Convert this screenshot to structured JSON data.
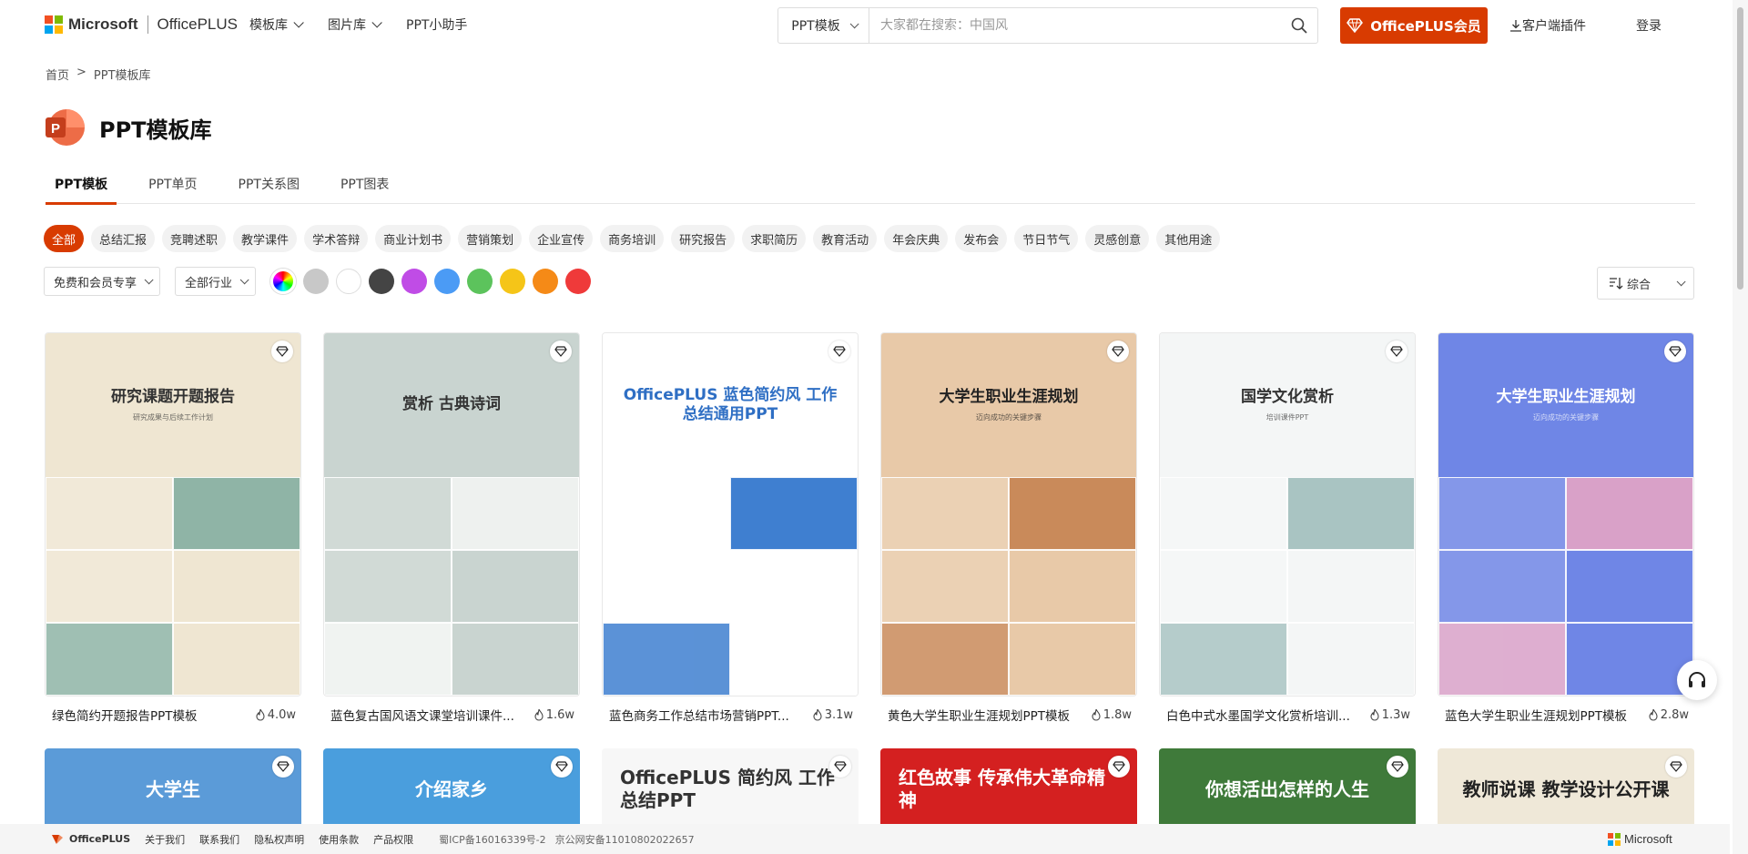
{
  "header": {
    "ms_text": "Microsoft",
    "brand": "OfficePLUS",
    "nav": [
      {
        "label": "模板库",
        "has_dropdown": true
      },
      {
        "label": "图片库",
        "has_dropdown": true
      },
      {
        "label": "PPT小助手",
        "has_dropdown": false
      }
    ],
    "search": {
      "type_label": "PPT模板",
      "placeholder": "大家都在搜索：中国风"
    },
    "vip_label": "OfficePLUS会员",
    "client_label": "客户端插件",
    "login_label": "登录"
  },
  "breadcrumb": {
    "home": "首页",
    "sep": ">",
    "current": "PPT模板库"
  },
  "page_title": "PPT模板库",
  "tabs": [
    "PPT模板",
    "PPT单页",
    "PPT关系图",
    "PPT图表"
  ],
  "categories": [
    "全部",
    "总结汇报",
    "竞聘述职",
    "教学课件",
    "学术答辩",
    "商业计划书",
    "营销策划",
    "企业宣传",
    "商务培训",
    "研究报告",
    "求职简历",
    "教育活动",
    "年会庆典",
    "发布会",
    "节日节气",
    "灵感创意",
    "其他用途"
  ],
  "filters": {
    "license_label": "免费和会员专享",
    "industry_label": "全部行业",
    "colors": [
      "rainbow",
      "#c8c8c8",
      "#ffffff",
      "#444444",
      "#c04ce6",
      "#4b9bf5",
      "#5cc35c",
      "#f5c518",
      "#f58a17",
      "#ef3a3a"
    ],
    "sort_label": "综合"
  },
  "cards": [
    {
      "title": "绿色简约开题报告PPT模板",
      "views": "4.0w",
      "cover_text": "研究课题开题报告",
      "cover_sub": "研究成果与后续工作计划",
      "bg": "#efe6d2",
      "accent": "#8fb4a6",
      "text_color": "#333333"
    },
    {
      "title": "蓝色复古国风语文课堂培训课件...",
      "views": "1.6w",
      "cover_text": "赏析 古典诗词",
      "cover_sub": "",
      "bg": "#c9d4d0",
      "accent": "#eef1ef",
      "text_color": "#333333"
    },
    {
      "title": "蓝色商务工作总结市场营销PPT...",
      "views": "3.1w",
      "cover_text": "OfficePLUS 蓝色简约风 工作总结通用PPT",
      "cover_sub": "",
      "bg": "#ffffff",
      "accent": "#3f7fd0",
      "text_color": "#2f6fc4"
    },
    {
      "title": "黄色大学生职业生涯规划PPT模板",
      "views": "1.8w",
      "cover_text": "大学生职业生涯规划",
      "cover_sub": "迈向成功的关键步骤",
      "bg": "#e8c9a8",
      "accent": "#c98a5a",
      "text_color": "#222222"
    },
    {
      "title": "白色中式水墨国学文化赏析培训...",
      "views": "1.3w",
      "cover_text": "国学文化赏析",
      "cover_sub": "培训课件PPT",
      "bg": "#f4f6f6",
      "accent": "#a9c4c2",
      "text_color": "#333333"
    },
    {
      "title": "蓝色大学生职业生涯规划PPT模板",
      "views": "2.8w",
      "cover_text": "大学生职业生涯规划",
      "cover_sub": "迈向成功的关键步骤",
      "bg": "#6f86e6",
      "accent": "#d9a1c8",
      "text_color": "#ffffff"
    }
  ],
  "row2": [
    {
      "cover_text": "大学生",
      "bg": "#5b9bd8",
      "text_color": "#ffffff"
    },
    {
      "cover_text": "介绍家乡",
      "bg": "#4a9edd",
      "text_color": "#ffffff"
    },
    {
      "cover_text": "OfficePLUS 简约风 工作总结PPT",
      "bg": "#f7f7f7",
      "text_color": "#333333"
    },
    {
      "cover_text": "红色故事 传承伟大革命精神",
      "bg": "#d42020",
      "text_color": "#ffffff"
    },
    {
      "cover_text": "你想活出怎样的人生",
      "bg": "#3f7a3a",
      "text_color": "#ffffff"
    },
    {
      "cover_text": "教师说课 教学设计公开课",
      "bg": "#efe8d8",
      "text_color": "#222222"
    }
  ],
  "footer": {
    "brand": "OfficePLUS",
    "links": [
      "关于我们",
      "联系我们",
      "隐私权声明",
      "使用条款",
      "产品权限"
    ],
    "icp": "蜀ICP备16016339号-2",
    "police": "京公网安备11010802022657",
    "ms_text": "Microsoft"
  }
}
